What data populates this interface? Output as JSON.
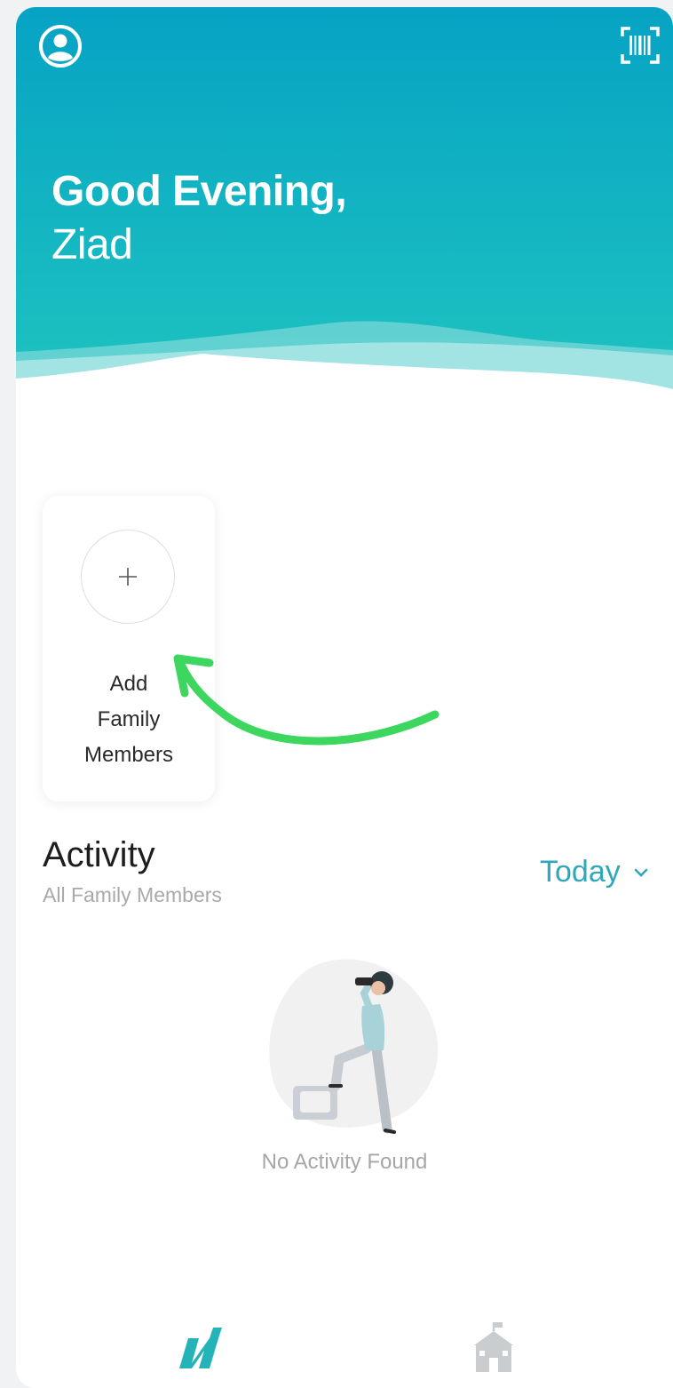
{
  "header": {
    "greeting": "Good Evening,",
    "name": "Ziad",
    "profile_icon": "user-circle-icon",
    "scan_icon": "barcode-scan-icon"
  },
  "family": {
    "add_label": "Add\nFamily\nMembers",
    "plus_glyph": "+"
  },
  "activity": {
    "title": "Activity",
    "subtitle": "All Family Members",
    "filter_label": "Today",
    "empty_text": "No Activity Found"
  },
  "nav": {
    "home_icon": "brand-logo-icon",
    "school_icon": "school-icon"
  },
  "colors": {
    "header_top": "#06a3c4",
    "header_bottom": "#1ec3c0",
    "accent": "#2fa8bd",
    "annotation_arrow": "#3dd65f"
  }
}
